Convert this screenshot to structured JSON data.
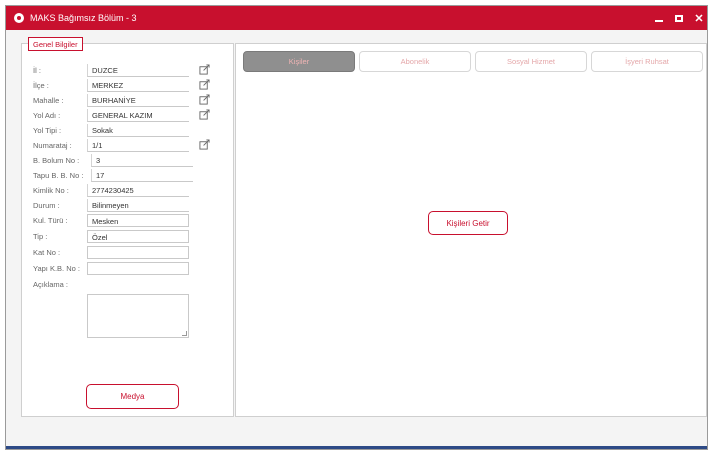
{
  "window": {
    "title": "MAKS Bağımsız Bölüm - 3",
    "controls": [
      "minimize",
      "maximize",
      "close"
    ],
    "close_glyph": "✕",
    "accent_color": "#c8102e",
    "bottom_accent_color": "#2d4a86"
  },
  "left_panel": {
    "legend": "Genel Bilgiler",
    "fields": [
      {
        "label": "İl :",
        "value": "DUZCE",
        "editable_icon": "edit-icon"
      },
      {
        "label": "İlçe :",
        "value": "MERKEZ",
        "editable_icon": "edit-icon"
      },
      {
        "label": "Mahalle :",
        "value": "BURHANİYE",
        "editable_icon": "edit-icon"
      },
      {
        "label": "Yol Adı :",
        "value": "GENERAL KAZIM",
        "editable_icon": "edit-icon"
      },
      {
        "label": "Yol Tipi :",
        "value": "Sokak"
      },
      {
        "label": "Numarataj :",
        "value": "1/1",
        "editable_icon": "edit-icon"
      },
      {
        "label": "B. Bolum No :",
        "value": "3"
      },
      {
        "label": "Tapu B. B. No :",
        "value": "17"
      },
      {
        "label": "Kimlik No :",
        "value": "2774230425"
      },
      {
        "label": "Durum :",
        "value": "Bilinmeyen"
      },
      {
        "label": "Kul. Türü :",
        "value": "Mesken"
      },
      {
        "label": "Tip :",
        "value": "Özel"
      },
      {
        "label": "Kat No :",
        "value": ""
      },
      {
        "label": "Yapı K.B. No :",
        "value": ""
      },
      {
        "label": "Açıklama :",
        "value": ""
      }
    ],
    "medya_button": "Medya"
  },
  "right_panel": {
    "tabs": [
      {
        "label": "Kişiler",
        "active": true
      },
      {
        "label": "Abonelik",
        "active": false
      },
      {
        "label": "Sosyal Hizmet",
        "active": false
      },
      {
        "label": "İşyeri Ruhsat",
        "active": false
      }
    ],
    "kisiler_button": "Kişileri Getir"
  }
}
